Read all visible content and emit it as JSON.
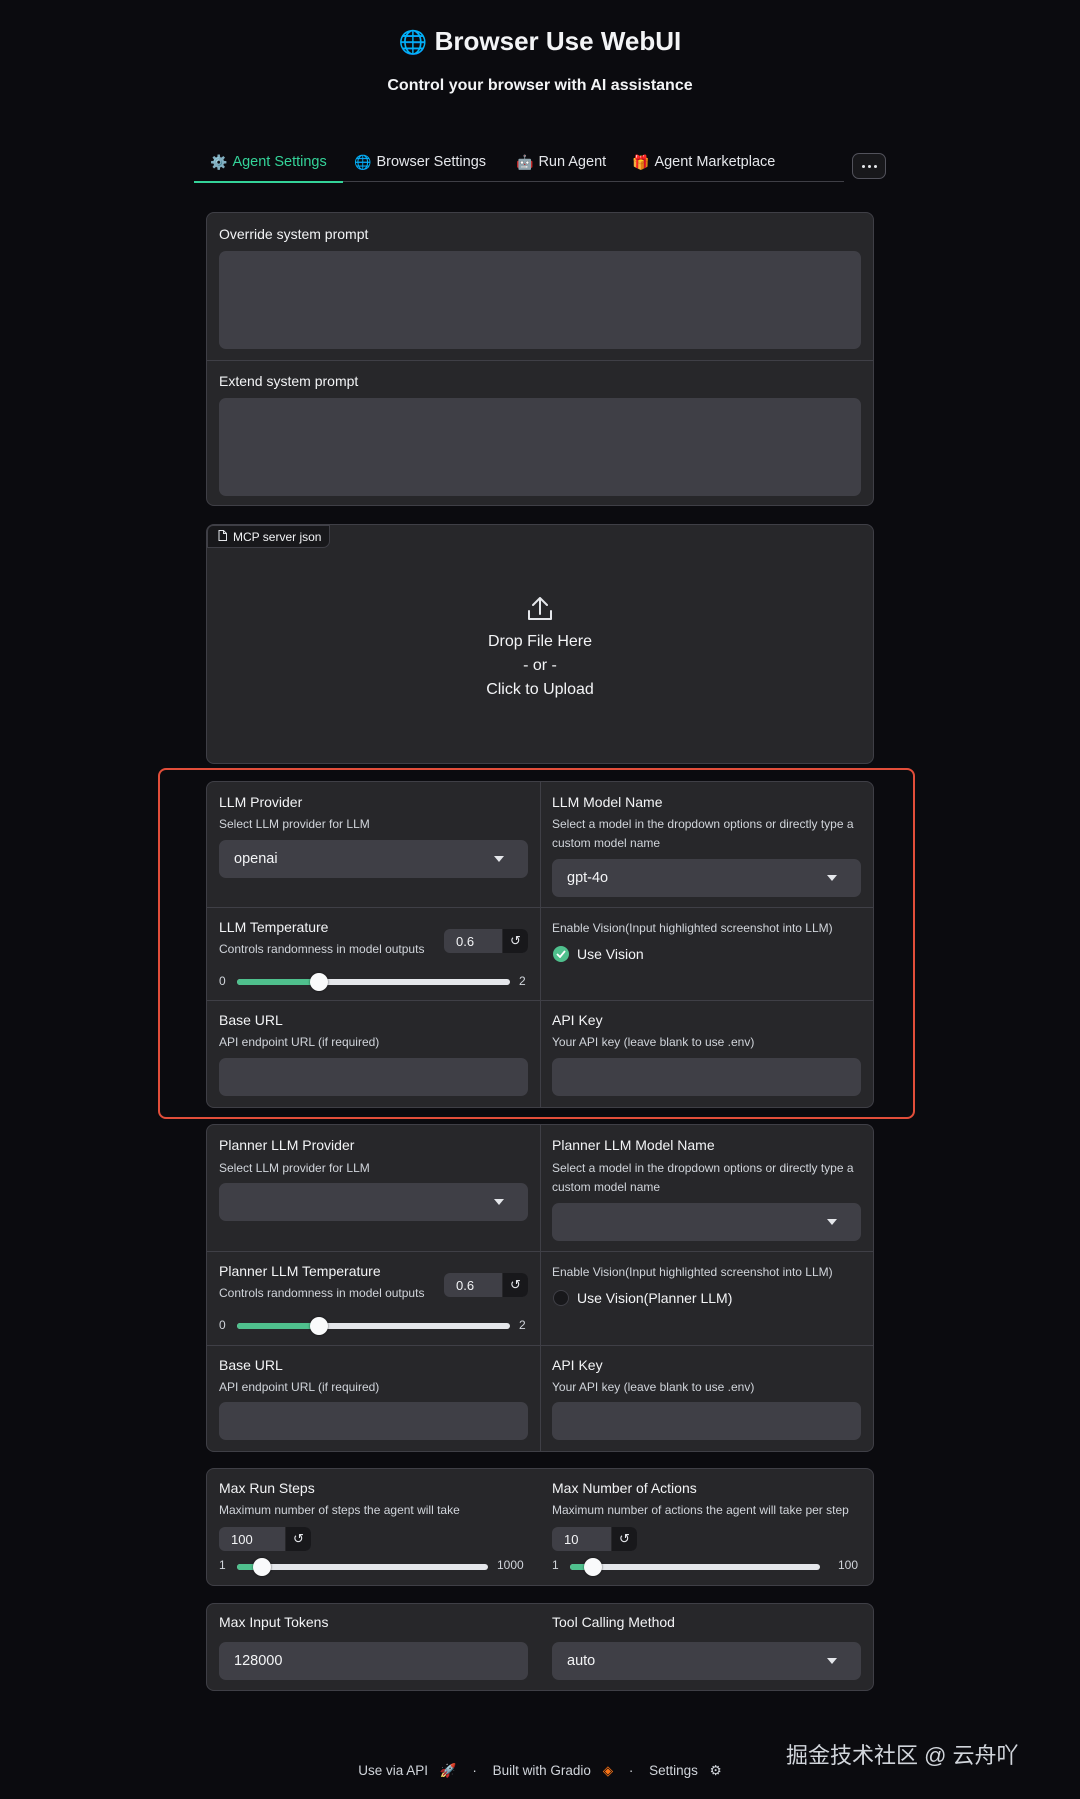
{
  "header": {
    "title": "Browser Use WebUI",
    "subtitle": "Control your browser with AI assistance"
  },
  "tabs": [
    {
      "label": "Agent Settings",
      "icon": "gear-icon",
      "emoji": "⚙️",
      "active": true
    },
    {
      "label": "Browser Settings",
      "icon": "globe-icon",
      "emoji": "🌐"
    },
    {
      "label": "Run Agent",
      "icon": "robot-icon",
      "emoji": "🤖"
    },
    {
      "label": "Agent Marketplace",
      "icon": "gift-icon",
      "emoji": "🎁"
    }
  ],
  "prompts": {
    "override_label": "Override system prompt",
    "extend_label": "Extend system prompt"
  },
  "upload": {
    "tag_label": "MCP server json",
    "drop_text": "Drop File Here",
    "or_text": "- or -",
    "click_text": "Click to Upload"
  },
  "llm": {
    "provider_label": "LLM Provider",
    "provider_info": "Select LLM provider for LLM",
    "provider_value": "openai",
    "model_label": "LLM Model Name",
    "model_info": "Select a model in the dropdown options or directly type a custom model name",
    "model_value": "gpt-4o",
    "temp_label": "LLM Temperature",
    "temp_info": "Controls randomness in model outputs",
    "temp_value": "0.6",
    "temp_min": "0",
    "temp_max": "2",
    "vision_info": "Enable Vision(Input highlighted screenshot into LLM)",
    "vision_label": "Use Vision",
    "vision_checked": true,
    "base_url_label": "Base URL",
    "base_url_info": "API endpoint URL (if required)",
    "api_key_label": "API Key",
    "api_key_info": "Your API key (leave blank to use .env)"
  },
  "planner": {
    "provider_label": "Planner LLM Provider",
    "provider_info": "Select LLM provider for LLM",
    "model_label": "Planner LLM Model Name",
    "model_info": "Select a model in the dropdown options or directly type a custom model name",
    "temp_label": "Planner LLM Temperature",
    "temp_info": "Controls randomness in model outputs",
    "temp_value": "0.6",
    "temp_min": "0",
    "temp_max": "2",
    "vision_info": "Enable Vision(Input highlighted screenshot into LLM)",
    "vision_label": "Use Vision(Planner LLM)",
    "vision_checked": false,
    "base_url_label": "Base URL",
    "base_url_info": "API endpoint URL (if required)",
    "api_key_label": "API Key",
    "api_key_info": "Your API key (leave blank to use .env)"
  },
  "steps": {
    "max_steps_label": "Max Run Steps",
    "max_steps_info": "Maximum number of steps the agent will take",
    "max_steps_value": "100",
    "max_steps_min": "1",
    "max_steps_max": "1000",
    "max_actions_label": "Max Number of Actions",
    "max_actions_info": "Maximum number of actions the agent will take per step",
    "max_actions_value": "10",
    "max_actions_min": "1",
    "max_actions_max": "100"
  },
  "tokens": {
    "max_tokens_label": "Max Input Tokens",
    "max_tokens_value": "128000",
    "tool_method_label": "Tool Calling Method",
    "tool_method_value": "auto"
  },
  "footer": {
    "api_link": "Use via API",
    "built_with": "Built with Gradio",
    "settings": "Settings",
    "separator": "·"
  },
  "watermark": "掘金技术社区 @ 云舟吖",
  "colors": {
    "accent": "#4fc08d",
    "highlight_box": "#e24e3a",
    "panel_bg": "#27272a",
    "page_bg": "#0b0b0f"
  }
}
